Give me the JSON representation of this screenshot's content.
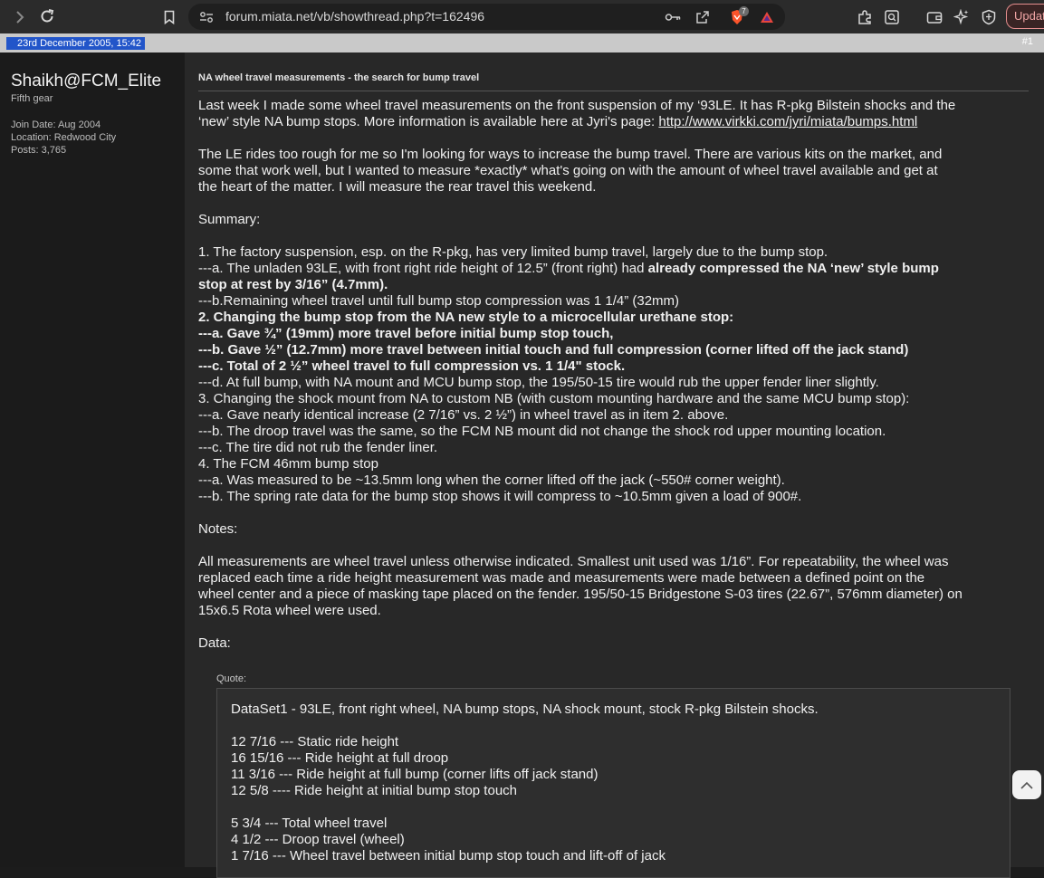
{
  "browser": {
    "url": "forum.miata.net/vb/showthread.php?t=162496",
    "shield_badge": "7",
    "update_label": "Update"
  },
  "post": {
    "date": "23rd December 2005, 15:42",
    "number": "#1",
    "title": "NA wheel travel measurements - the search for bump travel"
  },
  "user": {
    "name": "Shaikh@FCM_Elite",
    "rank": "Fifth gear",
    "join_date": "Join Date: Aug 2004",
    "location": "Location: Redwood City",
    "posts": "Posts: 3,765"
  },
  "body": {
    "p1_l1": "Last week I made some wheel travel measurements on the front suspension of my ‘93LE. It has R-pkg Bilstein shocks and the",
    "p1_l2_pre": "‘new’ style NA bump stops. More information is available here at Jyri's page: ",
    "p1_link": "http://www.virkki.com/jyri/miata/bumps.html",
    "p2_l1": "The LE rides too rough for me so I'm looking for ways to increase the bump travel. There are various kits on the market, and",
    "p2_l2": "some that work well, but I wanted to measure *exactly* what's going on with the amount of wheel travel available and get at",
    "p2_l3": "the heart of the matter. I will measure the rear travel this weekend.",
    "summary": "Summary:",
    "s1": "1. The factory suspension, esp. on the R-pkg, has very limited bump travel, largely due to the bump stop.",
    "s1a_pre": "---a. The unladen 93LE, with front right ride height of 12.5” (front right) had ",
    "s1a_bold1": "already compressed the NA ‘new’ style bump",
    "s1a_bold2": "stop at rest by 3/16” (4.7mm).",
    "s1b": "---b.Remaining wheel travel until full bump stop compression was 1 1/4” (32mm)",
    "s2": "2. Changing the bump stop from the NA new style to a microcellular urethane stop:",
    "s2a": "---a. Gave ¾” (19mm) more travel before initial bump stop touch,",
    "s2b": "---b. Gave ½” (12.7mm) more travel between initial touch and full compression (corner lifted off the jack stand)",
    "s2c": "---c. Total of 2 ½” wheel travel to full compression vs. 1 1/4\" stock.",
    "s2d": "---d. At full bump, with NA mount and MCU bump stop, the 195/50-15 tire would rub the upper fender liner slightly.",
    "s3": "3. Changing the shock mount from NA to custom NB (with custom mounting hardware and the same MCU bump stop):",
    "s3a": "---a. Gave nearly identical increase (2 7/16” vs. 2 ½”) in wheel travel as in item 2. above.",
    "s3b": "---b. The droop travel was the same, so the FCM NB mount did not change the shock rod upper mounting location.",
    "s3c": "---c. The tire did not rub the fender liner.",
    "s4": "4. The FCM 46mm bump stop",
    "s4a": "---a. Was measured to be ~13.5mm long when the corner lifted off the jack (~550# corner weight).",
    "s4b": "---b. The spring rate data for the bump stop shows it will compress to ~10.5mm given a load of 900#.",
    "notes": "Notes:",
    "n1": "All measurements are wheel travel unless otherwise indicated. Smallest unit used was 1/16”. For repeatability, the wheel was",
    "n2": "replaced each time a ride height measurement was made and measurements were made between a defined point on the",
    "n3": "wheel center and a piece of masking tape placed on the fender. 195/50-15 Bridgestone S-03 tires (22.67”, 576mm diameter) on",
    "n4": "15x6.5 Rota wheel were used.",
    "data": "Data:"
  },
  "quote": {
    "label": "Quote:",
    "q1": "DataSet1 - 93LE, front right wheel, NA bump stops, NA shock mount, stock R-pkg Bilstein shocks.",
    "q2": "12 7/16 --- Static ride height",
    "q3": "16 15/16 --- Ride height at full droop",
    "q4": "11 3/16 --- Ride height at full bump (corner lifts off jack stand)",
    "q5": "12 5/8 ---- Ride height at initial bump stop touch",
    "q6": "5 3/4 --- Total wheel travel",
    "q7": "4 1/2 --- Droop travel (wheel)",
    "q8": "1 7/16 --- Wheel travel between initial bump stop touch and lift-off of jack"
  }
}
